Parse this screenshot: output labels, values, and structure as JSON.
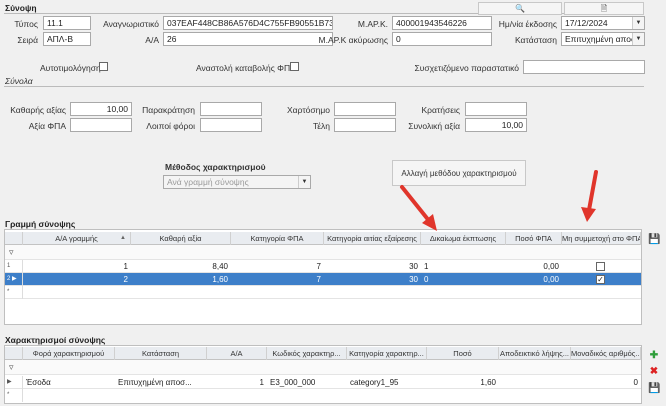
{
  "summary": {
    "title": "Σύνοψη",
    "type_label": "Τύπος",
    "type_value": "11.1",
    "series_label": "Σειρά",
    "series_value": "ΑΠΛ-Β",
    "uid_label": "Αναγνωριστικό",
    "uid_value": "037EAF448CB86A576D4C755FB90551B73",
    "aa_label": "Α/Α",
    "aa_value": "26",
    "mark_label": "Μ.ΑΡ.Κ.",
    "mark_value": "400001943546226",
    "mark_cancel_label": "Μ.ΑΡ.Κ ακύρωσης",
    "mark_cancel_value": "0",
    "issue_date_label": "Ημ/νία έκδοσης",
    "issue_date_value": "17/12/2024",
    "status_label": "Κατάσταση",
    "status_value": "Επιτυχημένη αποστολή",
    "self_pricing_label": "Αυτοτιμολόγηση",
    "vat_suspension_label": "Αναστολή καταβολής ΦΠΑ",
    "related_doc_label": "Συσχετιζόμενο παραστατικό",
    "related_doc_value": ""
  },
  "totals": {
    "title": "Σύνολα",
    "net_label": "Καθαρής αξίας",
    "net_value": "10,00",
    "vat_label": "Αξία ΦΠΑ",
    "vat_value": "",
    "withholding_label": "Παρακράτηση",
    "withholding_value": "",
    "other_taxes_label": "Λοιποί φόροι",
    "other_taxes_value": "",
    "stamp_label": "Χαρτόσημο",
    "stamp_value": "",
    "fees_label": "Τέλη",
    "fees_value": "",
    "deductions_label": "Κρατήσεις",
    "deductions_value": "",
    "total_label": "Συνολική αξία",
    "total_value": "10,00"
  },
  "method": {
    "title": "Μέθοδος χαρακτηρισμού",
    "selected": "Ανά γραμμή σύνοψης",
    "change_button": "Αλλαγή μεθόδου χαρακτηρισμού"
  },
  "lines_grid": {
    "title": "Γραμμή σύνοψης",
    "columns": [
      "Α/Α γραμμής",
      "Καθαρή αξία",
      "Κατηγορία ΦΠΑ",
      "Κατηγορία αιτίας εξαίρεσης",
      "Δικαίωμα έκπτωσης",
      "Ποσό ΦΠΑ",
      "Μη συμμετοχή στο ΦΠΑ"
    ],
    "rows": [
      {
        "row_no": "1",
        "aa": "1",
        "net": "8,40",
        "vat_cat": "7",
        "exempt": "30",
        "deduct": "1",
        "vat_amount": "0,00",
        "nonpart": false
      },
      {
        "row_no": "2",
        "aa": "2",
        "net": "1,60",
        "vat_cat": "7",
        "exempt": "30",
        "deduct": "0",
        "vat_amount": "0,00",
        "nonpart": true
      }
    ],
    "new_row_marker": "*"
  },
  "char_grid": {
    "title": "Χαρακτηρισμοί σύνοψης",
    "columns": [
      "Φορά χαρακτηρισμού",
      "Κατάσταση",
      "Α/Α",
      "Κωδικός χαρακτηρ...",
      "Κατηγορία χαρακτηρ...",
      "Ποσό",
      "Αποδεικτικό λήψης...",
      "Μοναδικός αριθμός..."
    ],
    "rows": [
      {
        "direction": "Έσοδα",
        "status": "Επιτυχημένη αποσ...",
        "aa": "1",
        "code": "E3_000_000",
        "category": "category1_95",
        "amount": "1,60",
        "proof": "",
        "unique": "0"
      }
    ],
    "new_row_marker": "*"
  },
  "colors": {
    "selection": "#3d7fc9",
    "arrow": "#e0352b",
    "header": "#e9ecf0"
  }
}
